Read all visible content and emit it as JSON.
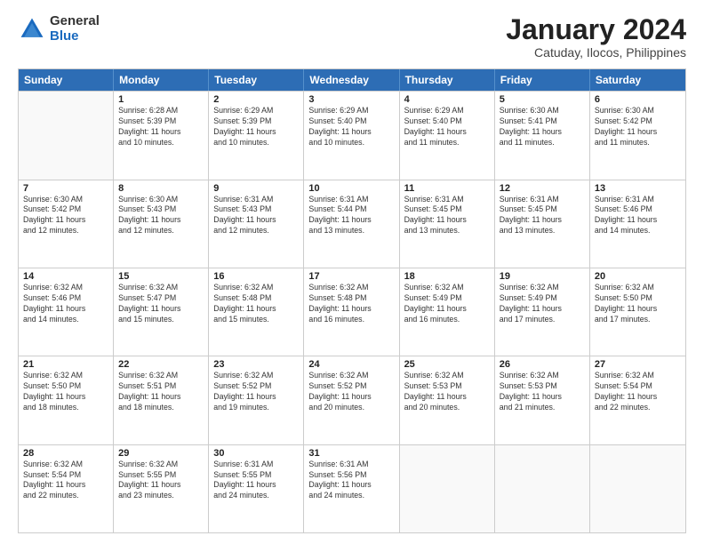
{
  "logo": {
    "general": "General",
    "blue": "Blue"
  },
  "title": "January 2024",
  "subtitle": "Catuday, Ilocos, Philippines",
  "header_days": [
    "Sunday",
    "Monday",
    "Tuesday",
    "Wednesday",
    "Thursday",
    "Friday",
    "Saturday"
  ],
  "weeks": [
    [
      {
        "day": "",
        "info": ""
      },
      {
        "day": "1",
        "info": "Sunrise: 6:28 AM\nSunset: 5:39 PM\nDaylight: 11 hours\nand 10 minutes."
      },
      {
        "day": "2",
        "info": "Sunrise: 6:29 AM\nSunset: 5:39 PM\nDaylight: 11 hours\nand 10 minutes."
      },
      {
        "day": "3",
        "info": "Sunrise: 6:29 AM\nSunset: 5:40 PM\nDaylight: 11 hours\nand 10 minutes."
      },
      {
        "day": "4",
        "info": "Sunrise: 6:29 AM\nSunset: 5:40 PM\nDaylight: 11 hours\nand 11 minutes."
      },
      {
        "day": "5",
        "info": "Sunrise: 6:30 AM\nSunset: 5:41 PM\nDaylight: 11 hours\nand 11 minutes."
      },
      {
        "day": "6",
        "info": "Sunrise: 6:30 AM\nSunset: 5:42 PM\nDaylight: 11 hours\nand 11 minutes."
      }
    ],
    [
      {
        "day": "7",
        "info": "Sunrise: 6:30 AM\nSunset: 5:42 PM\nDaylight: 11 hours\nand 12 minutes."
      },
      {
        "day": "8",
        "info": "Sunrise: 6:30 AM\nSunset: 5:43 PM\nDaylight: 11 hours\nand 12 minutes."
      },
      {
        "day": "9",
        "info": "Sunrise: 6:31 AM\nSunset: 5:43 PM\nDaylight: 11 hours\nand 12 minutes."
      },
      {
        "day": "10",
        "info": "Sunrise: 6:31 AM\nSunset: 5:44 PM\nDaylight: 11 hours\nand 13 minutes."
      },
      {
        "day": "11",
        "info": "Sunrise: 6:31 AM\nSunset: 5:45 PM\nDaylight: 11 hours\nand 13 minutes."
      },
      {
        "day": "12",
        "info": "Sunrise: 6:31 AM\nSunset: 5:45 PM\nDaylight: 11 hours\nand 13 minutes."
      },
      {
        "day": "13",
        "info": "Sunrise: 6:31 AM\nSunset: 5:46 PM\nDaylight: 11 hours\nand 14 minutes."
      }
    ],
    [
      {
        "day": "14",
        "info": "Sunrise: 6:32 AM\nSunset: 5:46 PM\nDaylight: 11 hours\nand 14 minutes."
      },
      {
        "day": "15",
        "info": "Sunrise: 6:32 AM\nSunset: 5:47 PM\nDaylight: 11 hours\nand 15 minutes."
      },
      {
        "day": "16",
        "info": "Sunrise: 6:32 AM\nSunset: 5:48 PM\nDaylight: 11 hours\nand 15 minutes."
      },
      {
        "day": "17",
        "info": "Sunrise: 6:32 AM\nSunset: 5:48 PM\nDaylight: 11 hours\nand 16 minutes."
      },
      {
        "day": "18",
        "info": "Sunrise: 6:32 AM\nSunset: 5:49 PM\nDaylight: 11 hours\nand 16 minutes."
      },
      {
        "day": "19",
        "info": "Sunrise: 6:32 AM\nSunset: 5:49 PM\nDaylight: 11 hours\nand 17 minutes."
      },
      {
        "day": "20",
        "info": "Sunrise: 6:32 AM\nSunset: 5:50 PM\nDaylight: 11 hours\nand 17 minutes."
      }
    ],
    [
      {
        "day": "21",
        "info": "Sunrise: 6:32 AM\nSunset: 5:50 PM\nDaylight: 11 hours\nand 18 minutes."
      },
      {
        "day": "22",
        "info": "Sunrise: 6:32 AM\nSunset: 5:51 PM\nDaylight: 11 hours\nand 18 minutes."
      },
      {
        "day": "23",
        "info": "Sunrise: 6:32 AM\nSunset: 5:52 PM\nDaylight: 11 hours\nand 19 minutes."
      },
      {
        "day": "24",
        "info": "Sunrise: 6:32 AM\nSunset: 5:52 PM\nDaylight: 11 hours\nand 20 minutes."
      },
      {
        "day": "25",
        "info": "Sunrise: 6:32 AM\nSunset: 5:53 PM\nDaylight: 11 hours\nand 20 minutes."
      },
      {
        "day": "26",
        "info": "Sunrise: 6:32 AM\nSunset: 5:53 PM\nDaylight: 11 hours\nand 21 minutes."
      },
      {
        "day": "27",
        "info": "Sunrise: 6:32 AM\nSunset: 5:54 PM\nDaylight: 11 hours\nand 22 minutes."
      }
    ],
    [
      {
        "day": "28",
        "info": "Sunrise: 6:32 AM\nSunset: 5:54 PM\nDaylight: 11 hours\nand 22 minutes."
      },
      {
        "day": "29",
        "info": "Sunrise: 6:32 AM\nSunset: 5:55 PM\nDaylight: 11 hours\nand 23 minutes."
      },
      {
        "day": "30",
        "info": "Sunrise: 6:31 AM\nSunset: 5:55 PM\nDaylight: 11 hours\nand 24 minutes."
      },
      {
        "day": "31",
        "info": "Sunrise: 6:31 AM\nSunset: 5:56 PM\nDaylight: 11 hours\nand 24 minutes."
      },
      {
        "day": "",
        "info": ""
      },
      {
        "day": "",
        "info": ""
      },
      {
        "day": "",
        "info": ""
      }
    ]
  ]
}
